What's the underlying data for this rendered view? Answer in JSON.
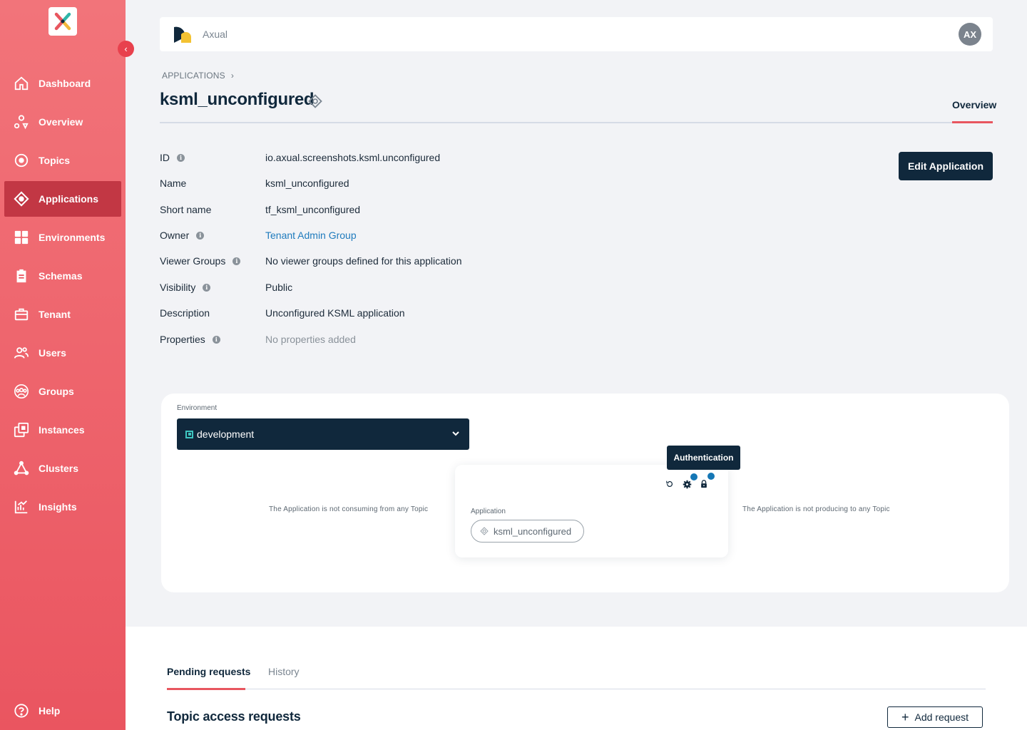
{
  "sidebar": {
    "items": [
      {
        "label": "Dashboard",
        "icon": "home-icon"
      },
      {
        "label": "Overview",
        "icon": "overview-icon"
      },
      {
        "label": "Topics",
        "icon": "topic-icon"
      },
      {
        "label": "Applications",
        "icon": "application-icon",
        "active": true
      },
      {
        "label": "Environments",
        "icon": "environment-icon"
      },
      {
        "label": "Schemas",
        "icon": "schema-icon"
      },
      {
        "label": "Tenant",
        "icon": "briefcase-icon"
      },
      {
        "label": "Users",
        "icon": "users-icon"
      },
      {
        "label": "Groups",
        "icon": "groups-icon"
      },
      {
        "label": "Instances",
        "icon": "instances-icon"
      },
      {
        "label": "Clusters",
        "icon": "clusters-icon"
      },
      {
        "label": "Insights",
        "icon": "insights-icon"
      }
    ],
    "help_label": "Help"
  },
  "topbar": {
    "tenant_name": "Axual",
    "avatar_initials": "AX"
  },
  "breadcrumb": {
    "label": "APPLICATIONS"
  },
  "page": {
    "title": "ksml_unconfigured",
    "tab_overview": "Overview",
    "edit_button": "Edit Application"
  },
  "details": {
    "id": {
      "label": "ID",
      "value": "io.axual.screenshots.ksml.unconfigured"
    },
    "name": {
      "label": "Name",
      "value": "ksml_unconfigured"
    },
    "short_name": {
      "label": "Short name",
      "value": "tf_ksml_unconfigured"
    },
    "owner": {
      "label": "Owner",
      "value": "Tenant Admin Group"
    },
    "viewer_groups": {
      "label": "Viewer Groups",
      "value": "No viewer groups defined for this application"
    },
    "visibility": {
      "label": "Visibility",
      "value": "Public"
    },
    "description": {
      "label": "Description",
      "value": "Unconfigured KSML application"
    },
    "properties": {
      "label": "Properties",
      "value": "No properties added"
    }
  },
  "graph": {
    "environment_label": "Environment",
    "environment_value": "development",
    "consuming_note": "The Application is not consuming from any Topic",
    "producing_note": "The Application is not producing to any Topic",
    "tooltip": "Authentication",
    "app_label": "Application",
    "app_name": "ksml_unconfigured"
  },
  "bottom": {
    "tab_pending": "Pending requests",
    "tab_history": "History",
    "section_title": "Topic access requests",
    "add_request": "Add request"
  },
  "colors": {
    "sidebar": "#ea5560",
    "sidebar_active": "#c23744",
    "navy": "#10283c",
    "accent": "#e8565f",
    "link": "#1f7bbd",
    "teal": "#3ec5c0"
  }
}
